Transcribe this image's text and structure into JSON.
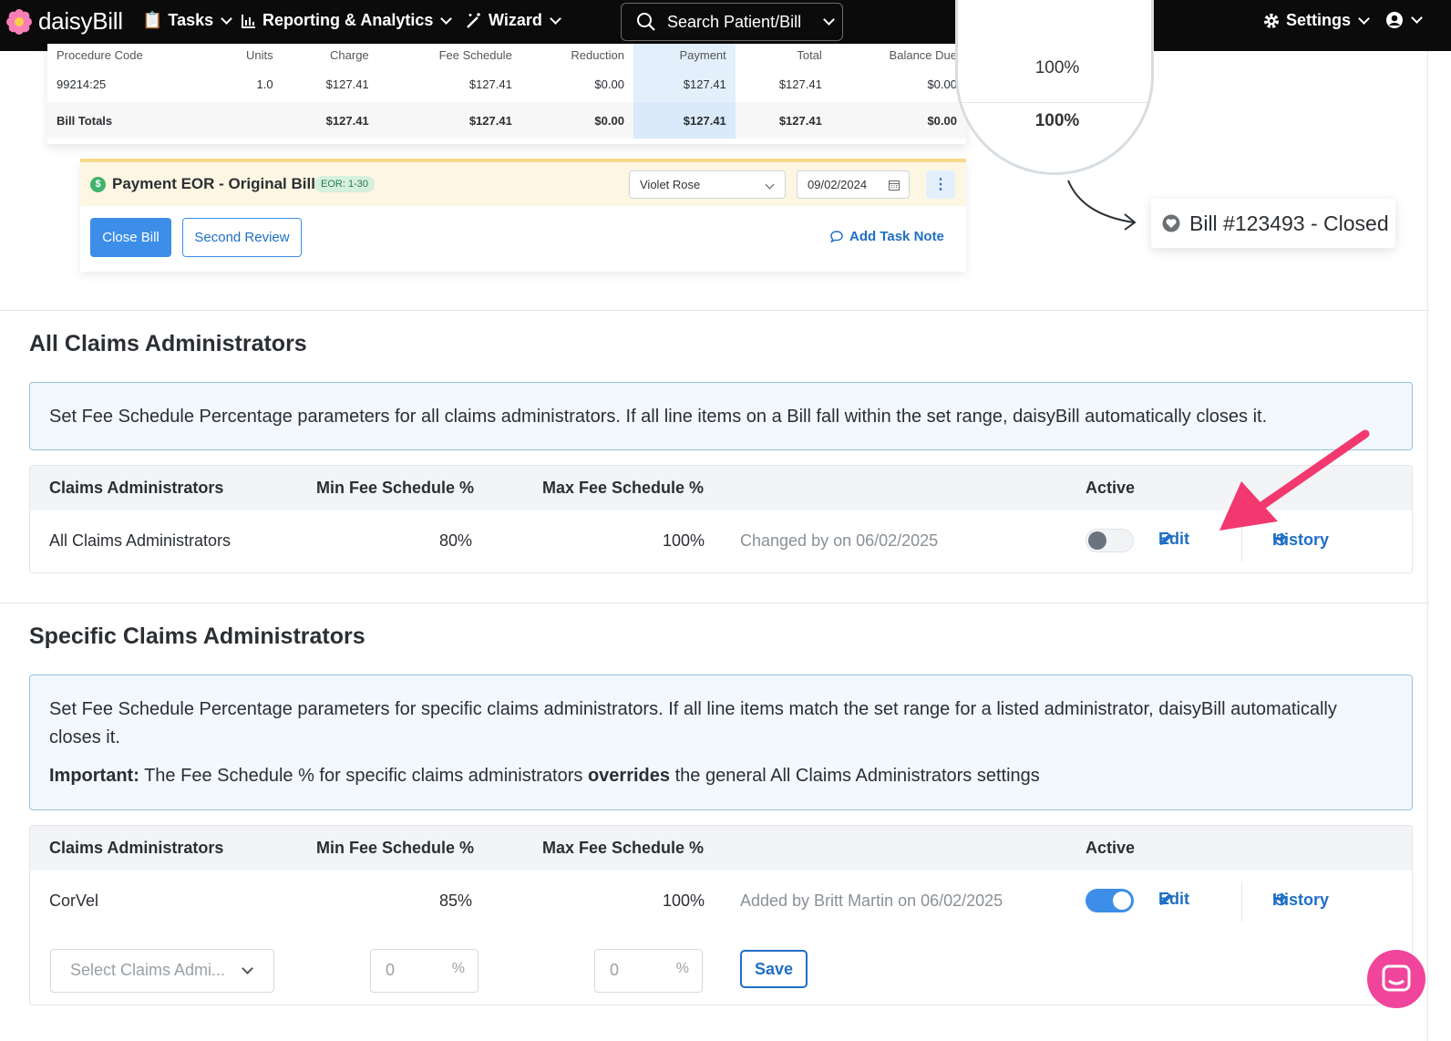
{
  "nav": {
    "logo": "daisyBill",
    "tasks": "Tasks",
    "reporting": "Reporting & Analytics",
    "wizard": "Wizard",
    "search": "Search Patient/Bill",
    "settings": "Settings"
  },
  "bill": {
    "headers": [
      "Procedure Code",
      "Units",
      "Charge",
      "Fee Schedule",
      "Reduction",
      "Payment",
      "Total",
      "Balance Due"
    ],
    "rows": [
      [
        "99214:25",
        "1.0",
        "$127.41",
        "$127.41",
        "$0.00",
        "$127.41",
        "$127.41",
        "$0.00"
      ],
      [
        "Bill Totals",
        "",
        "$127.41",
        "$127.41",
        "$0.00",
        "$127.41",
        "$127.41",
        "$0.00"
      ]
    ],
    "eor_title": "Payment EOR - Original Bill",
    "eor_badge": "EOR: 1-30",
    "assignee": "Violet Rose",
    "date": "09/02/2024",
    "close_bill": "Close Bill",
    "second_review": "Second Review",
    "add_task_note": "Add Task Note",
    "magnifier_top": "100%",
    "magnifier_bottom": "100%",
    "status_tag": "Bill #123493 - Closed"
  },
  "all_admins": {
    "title": "All Claims Administrators",
    "info": "Set Fee Schedule Percentage parameters for all claims administrators. If all line items on a Bill fall within the set range, daisyBill automatically closes it.",
    "headers": {
      "admin": "Claims Administrators",
      "min": "Min Fee Schedule %",
      "max": "Max Fee Schedule %",
      "active": "Active"
    },
    "row": {
      "name": "All Claims Administrators",
      "min": "80%",
      "max": "100%",
      "changed": "Changed by on 06/02/2025",
      "active": false,
      "edit": "Edit",
      "history": "History"
    }
  },
  "specific_admins": {
    "title": "Specific Claims Administrators",
    "info": "Set Fee Schedule Percentage parameters for specific claims administrators. If all line items match the set range for a listed administrator, daisyBill automatically closes it.",
    "important_label": "Important:",
    "important_pre": "The Fee Schedule % for specific claims administrators",
    "important_bold": "overrides",
    "important_post": "the general All Claims Administrators settings",
    "headers": {
      "admin": "Claims Administrators",
      "min": "Min Fee Schedule %",
      "max": "Max Fee Schedule %",
      "active": "Active"
    },
    "row": {
      "name": "CorVel",
      "min": "85%",
      "max": "100%",
      "added": "Added by Britt Martin on 06/02/2025",
      "active": true,
      "edit": "Edit",
      "history": "History"
    },
    "form": {
      "select_placeholder": "Select Claims Admi...",
      "min_value": "0",
      "max_value": "0",
      "pct": "%",
      "save": "Save"
    }
  },
  "colors": {
    "accent": "#1f6fc5",
    "arrow": "#f2386f",
    "chat": "#f0459a"
  }
}
